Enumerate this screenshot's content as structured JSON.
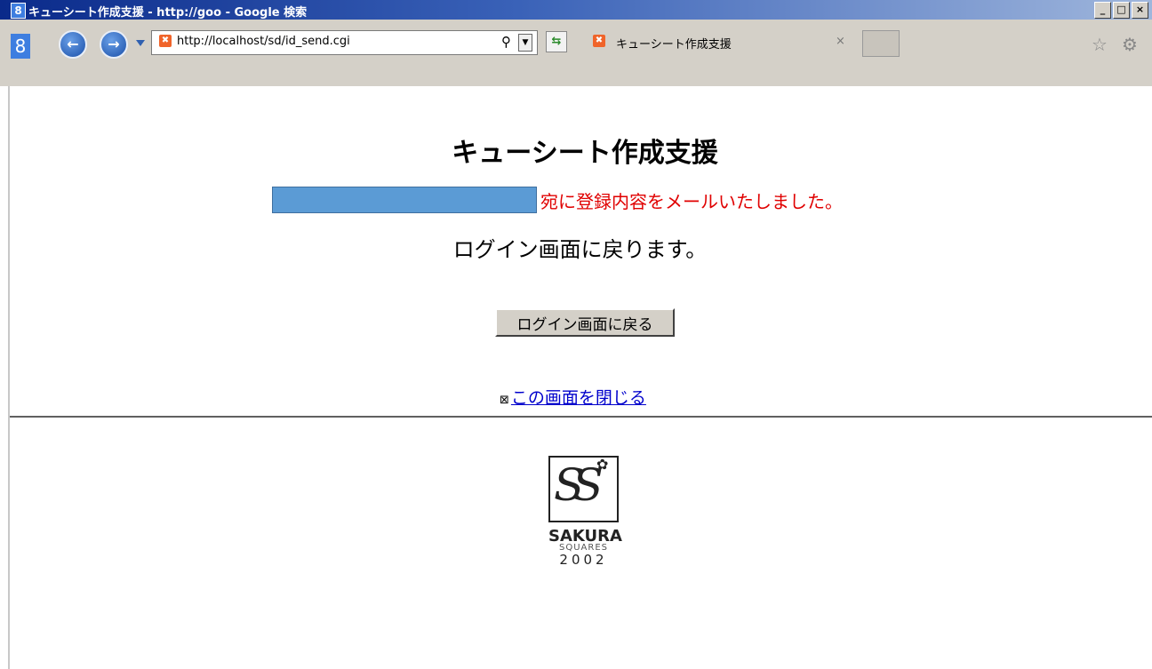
{
  "window": {
    "title": "キューシート作成支援 - http://goo - Google 検索",
    "controls": {
      "minimize": "_",
      "maximize": "□",
      "close": "×"
    }
  },
  "toolbar": {
    "app_icon": "8",
    "url": "http://localhost/sd/id_send.cgi",
    "tab_label": "キューシート作成支援",
    "tab_close": "×",
    "icons": {
      "back": "back-arrow-icon",
      "forward": "forward-arrow-icon",
      "search": "search-icon",
      "refresh": "refresh-icon",
      "favorites": "star-icon",
      "settings": "gear-icon"
    }
  },
  "page": {
    "title": "キューシート作成支援",
    "sent_message": "宛に登録内容をメールいたしました。",
    "return_message": "ログイン画面に戻ります。",
    "login_button": "ログイン画面に戻る",
    "close_link": "この画面を閉じる"
  },
  "logo": {
    "mark": "SS",
    "name": "SAKURA",
    "sub": "SQUARES",
    "year": "2002"
  },
  "colors": {
    "email_box": "#5b9bd5",
    "message_red": "#e00000",
    "link_blue": "#0000cc"
  }
}
